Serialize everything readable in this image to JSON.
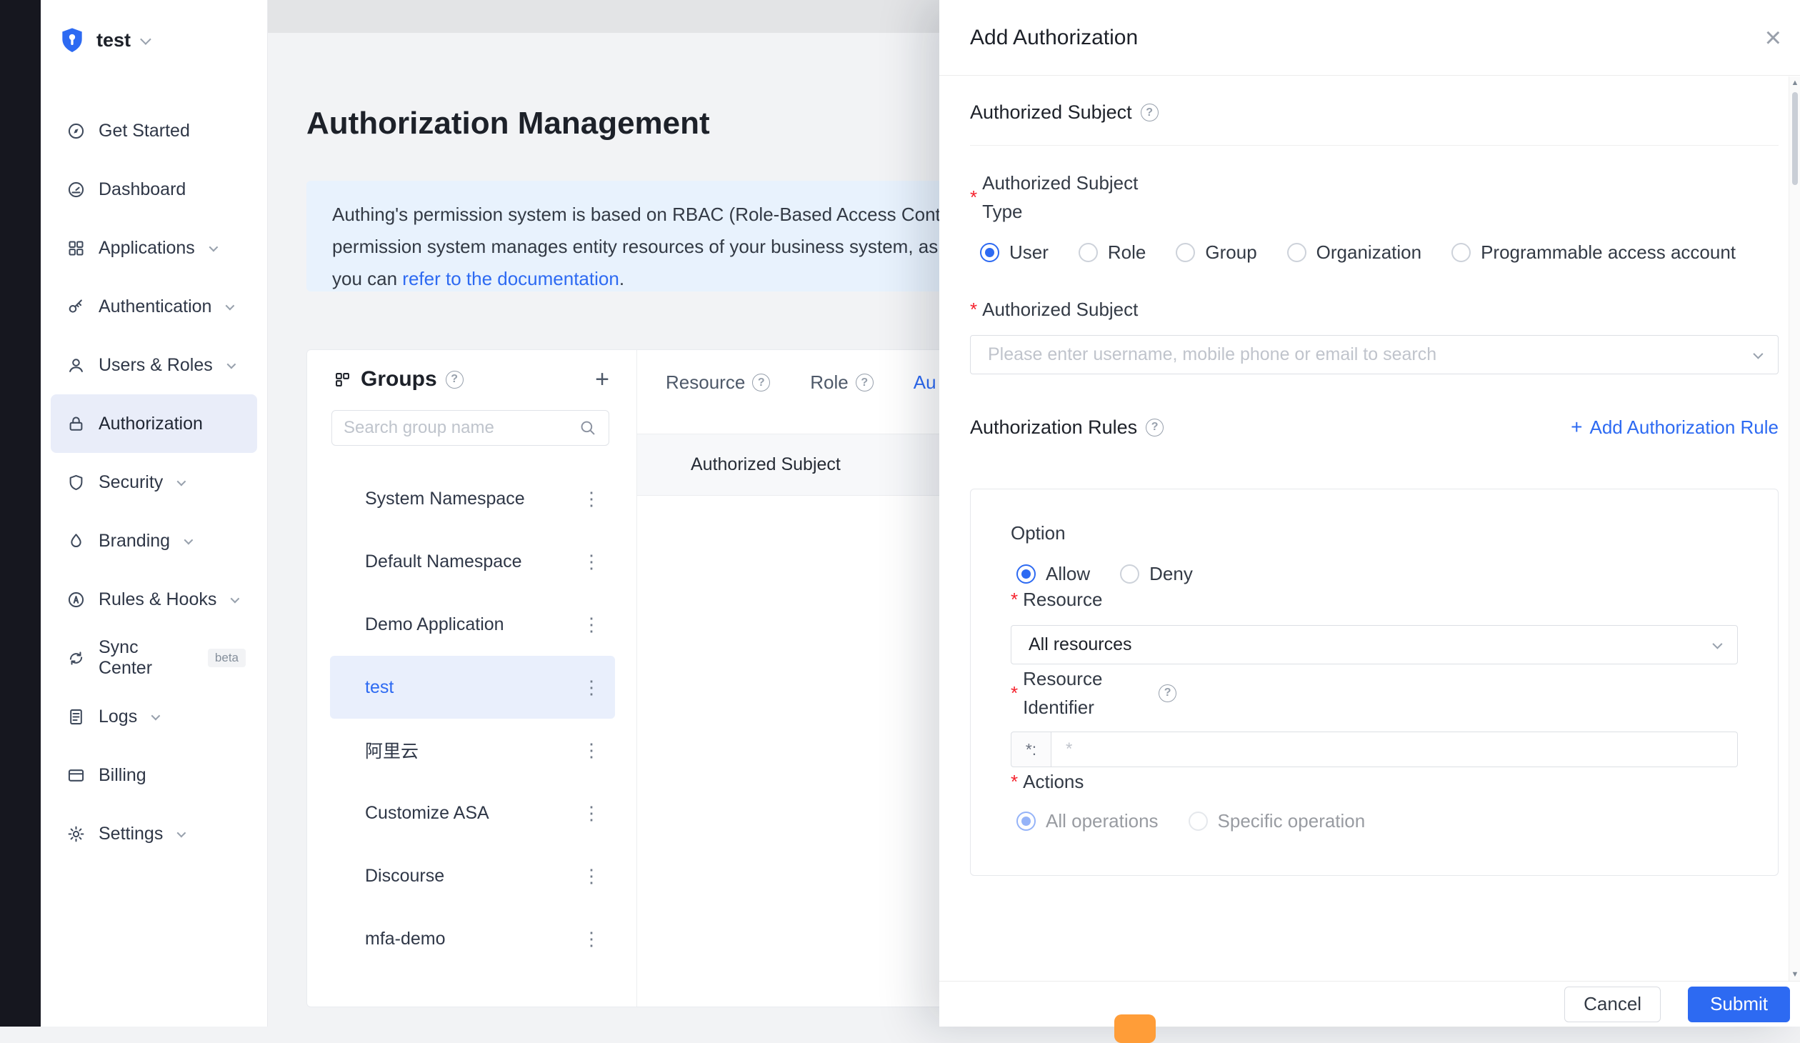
{
  "colors": {
    "accent": "#2d6af2",
    "alert_bg": "#e8f2fd",
    "sidebar_selected_bg": "#e9edf9",
    "selected_row_bg": "#e9effc",
    "danger": "#f5222d",
    "orange_widget": "#ff9d38"
  },
  "glyphs": {
    "help": "?",
    "plus": "+",
    "dots": "⋮",
    "close": "×",
    "arrow_up": "▲",
    "arrow_down": "▼"
  },
  "sidebar": {
    "logo_label": "test",
    "items": [
      {
        "label": "Get Started"
      },
      {
        "label": "Dashboard"
      },
      {
        "label": "Applications"
      },
      {
        "label": "Authentication"
      },
      {
        "label": "Users & Roles"
      },
      {
        "label": "Authorization"
      },
      {
        "label": "Security"
      },
      {
        "label": "Branding"
      },
      {
        "label": "Rules & Hooks"
      },
      {
        "label": "Sync Center",
        "badge": "beta"
      },
      {
        "label": "Logs"
      },
      {
        "label": "Billing"
      },
      {
        "label": "Settings"
      }
    ]
  },
  "main": {
    "title": "Authorization Management",
    "alert": {
      "line1": "Authing's permission system is based on RBAC (Role-Based Access Cont",
      "line2": "permission system manages entity resources of your business system, as",
      "line3_prefix": "you can ",
      "line3_link": "refer to the documentation",
      "line3_suffix": "."
    },
    "groups": {
      "title": "Groups",
      "search_placeholder": "Search group name",
      "items": [
        {
          "name": "System Namespace"
        },
        {
          "name": "Default Namespace"
        },
        {
          "name": "Demo Application"
        },
        {
          "name": "test"
        },
        {
          "name": "阿里云"
        },
        {
          "name": "Customize ASA"
        },
        {
          "name": "Discourse"
        },
        {
          "name": "mfa-demo"
        }
      ]
    },
    "tabs": [
      {
        "label": "Resource"
      },
      {
        "label": "Role"
      },
      {
        "label": "Au"
      }
    ],
    "table": {
      "header": "Authorized Subject"
    }
  },
  "drawer": {
    "title": "Add Authorization",
    "required_mark": "*",
    "subject_header": "Authorized Subject",
    "subject_type": {
      "label": "Authorized Subject Type",
      "options": [
        {
          "label": "User",
          "checked": true
        },
        {
          "label": "Role"
        },
        {
          "label": "Group"
        },
        {
          "label": "Organization"
        },
        {
          "label": "Programmable access account"
        }
      ]
    },
    "subject_field": {
      "label": "Authorized Subject",
      "placeholder": "Please enter username, mobile phone or email to search"
    },
    "rules_header": "Authorization Rules",
    "add_rule_label": "Add Authorization Rule",
    "rule": {
      "option_label": "Option",
      "option_choices": [
        {
          "label": "Allow",
          "checked": true
        },
        {
          "label": "Deny"
        }
      ],
      "resource_label": "Resource",
      "resource_value": "All resources",
      "identifier_label": "Resource Identifier",
      "identifier_prefix": "*:",
      "identifier_placeholder": "*",
      "actions_label": "Actions",
      "actions_choices": [
        {
          "label": "All operations",
          "checked": true
        },
        {
          "label": "Specific operation"
        }
      ]
    },
    "footer": {
      "cancel": "Cancel",
      "submit": "Submit"
    }
  }
}
